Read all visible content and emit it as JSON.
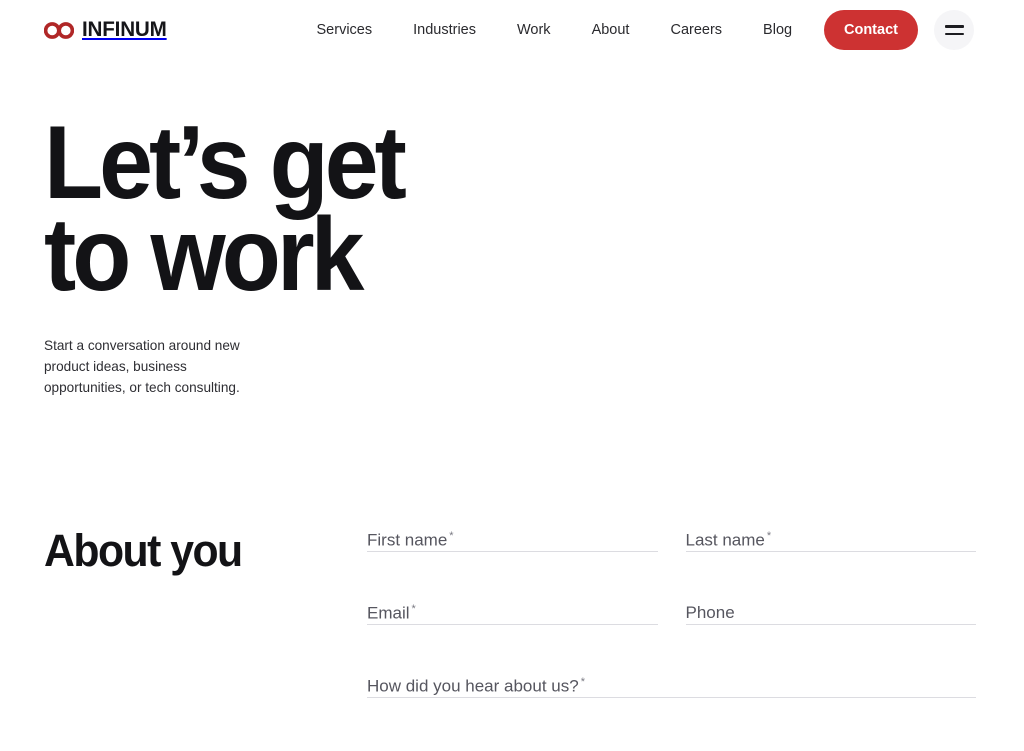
{
  "brand": {
    "logo_icon": "infinity-icon",
    "logo_text": "INFINUM",
    "accent_color": "#cd3232",
    "text_color": "#131316",
    "underline_color": "#dcdce1",
    "menu_circle_color": "#f5f5f7"
  },
  "header": {
    "nav_items": [
      {
        "label": "Services"
      },
      {
        "label": "Industries"
      },
      {
        "label": "Work"
      },
      {
        "label": "About"
      },
      {
        "label": "Careers"
      },
      {
        "label": "Blog"
      }
    ],
    "contact_label": "Contact",
    "menu_icon": "hamburger-menu-icon"
  },
  "hero": {
    "title": "Let’s get\nto work",
    "subtitle": "Start a conversation around new product ideas, business opportunities, or tech consulting."
  },
  "form_section": {
    "title": "About you",
    "required_marker": "*",
    "fields": [
      {
        "name": "first-name",
        "label": "First name",
        "placeholder": "First name",
        "value": "",
        "required": true
      },
      {
        "name": "last-name",
        "label": "Last name",
        "placeholder": "Last name",
        "value": "",
        "required": true
      },
      {
        "name": "email",
        "label": "Email",
        "placeholder": "Email",
        "value": "",
        "required": true
      },
      {
        "name": "phone",
        "label": "Phone",
        "placeholder": "Phone",
        "value": "",
        "required": false
      },
      {
        "name": "how-did-you-hear",
        "label": "How did you hear about us?",
        "placeholder": "How did you hear about us?",
        "value": "",
        "required": true
      }
    ]
  }
}
